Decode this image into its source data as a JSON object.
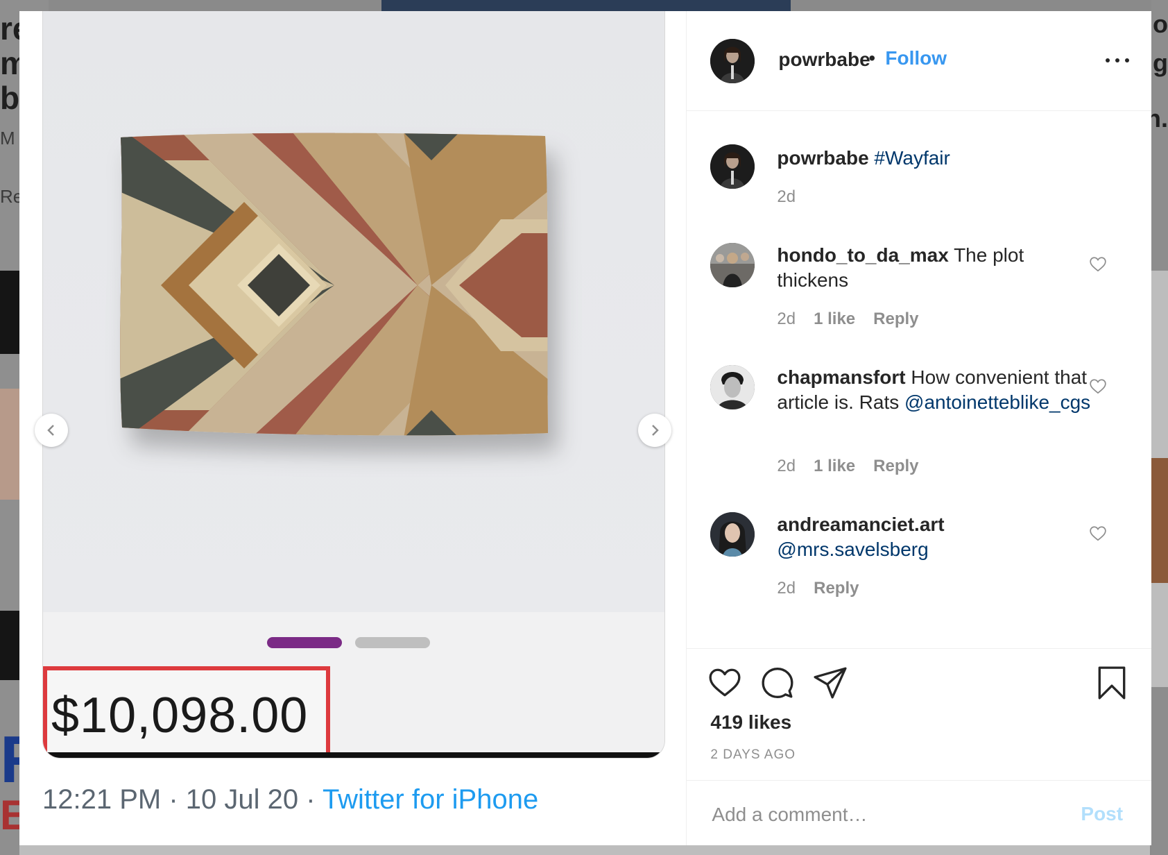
{
  "post": {
    "author": "powrbabe",
    "follow_label": "Follow",
    "separator": "•",
    "caption_hashtag": "#Wayfair",
    "caption_time": "2d",
    "likes": "419 likes",
    "time_ago": "2 DAYS AGO"
  },
  "media": {
    "price": "$10,098.00",
    "tweet_time": "12:21 PM · 10 Jul 20 · ",
    "tweet_source": "Twitter for iPhone",
    "pager_total": 2,
    "pager_active": 1
  },
  "comments": [
    {
      "username": "hondo_to_da_max",
      "text": " The plot thickens",
      "time": "2d",
      "likes": "1 like",
      "reply": "Reply"
    },
    {
      "username": "chapmansfort",
      "text": " How convenient that article is. Rats ",
      "mention": "@antoinetteblike_cgs",
      "time": "2d",
      "likes": "1 like",
      "reply": "Reply"
    },
    {
      "username": "andreamanciet.art",
      "mention": "@mrs.savelsberg",
      "time": "2d",
      "reply": "Reply"
    }
  ],
  "comment_box": {
    "placeholder": "Add a comment…",
    "post_label": "Post"
  },
  "colors": {
    "follow": "#3897f0",
    "hashtag": "#00376b",
    "price_border": "#dd3a3e",
    "pager_active": "#7b2b86",
    "twitter_blue": "#1d9bf0",
    "post_disabled": "#b2dffc"
  },
  "icons": [
    "chevron-left-icon",
    "chevron-right-icon",
    "more-icon",
    "heart-icon",
    "comment-icon",
    "share-icon",
    "bookmark-icon"
  ]
}
